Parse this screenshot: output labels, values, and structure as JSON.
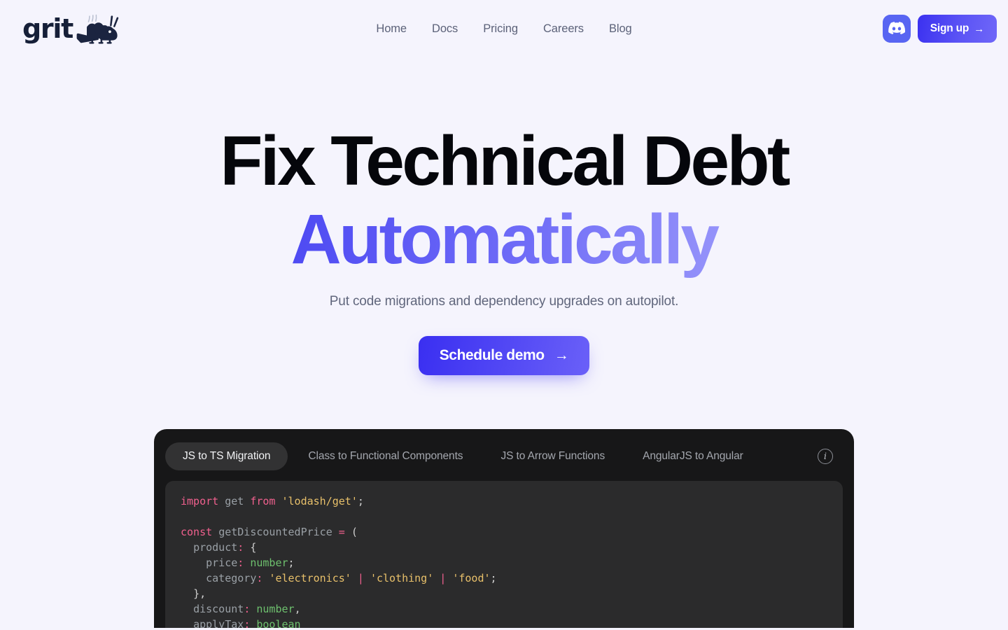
{
  "brand": {
    "word": "grit",
    "mascot_icon": "cricket-mascot-icon"
  },
  "nav": {
    "items": [
      {
        "label": "Home"
      },
      {
        "label": "Docs"
      },
      {
        "label": "Pricing"
      },
      {
        "label": "Careers"
      },
      {
        "label": "Blog"
      }
    ]
  },
  "header_actions": {
    "discord_icon": "discord-icon",
    "discord_bg": "#5865f2",
    "signup_label": "Sign up",
    "signup_arrow": "→"
  },
  "hero": {
    "title_line1": "Fix Technical Debt",
    "title_line2": "Automatically",
    "subtitle": "Put code migrations and dependency upgrades on autopilot.",
    "cta_label": "Schedule demo",
    "cta_arrow": "→",
    "gradient_start": "#2b2ae8",
    "gradient_end": "#c3c2fd"
  },
  "demo": {
    "tabs": [
      {
        "label": "JS to TS Migration",
        "active": true
      },
      {
        "label": "Class to Functional Components",
        "active": false
      },
      {
        "label": "JS to Arrow Functions",
        "active": false
      },
      {
        "label": "AngularJS to Angular",
        "active": false
      }
    ],
    "info_icon": "info-circle-icon",
    "code_lines": [
      {
        "id": "l1",
        "text": "import get from 'lodash/get';"
      },
      {
        "id": "l2",
        "text": ""
      },
      {
        "id": "l3",
        "text": "const getDiscountedPrice = ("
      },
      {
        "id": "l4",
        "text": "  product: {"
      },
      {
        "id": "l5",
        "text": "    price: number;"
      },
      {
        "id": "l6",
        "text": "    category: 'electronics' | 'clothing' | 'food';"
      },
      {
        "id": "l7",
        "text": "  },"
      },
      {
        "id": "l8",
        "text": "  discount: number,"
      },
      {
        "id": "l9",
        "text": "  applyTax: boolean"
      }
    ]
  }
}
